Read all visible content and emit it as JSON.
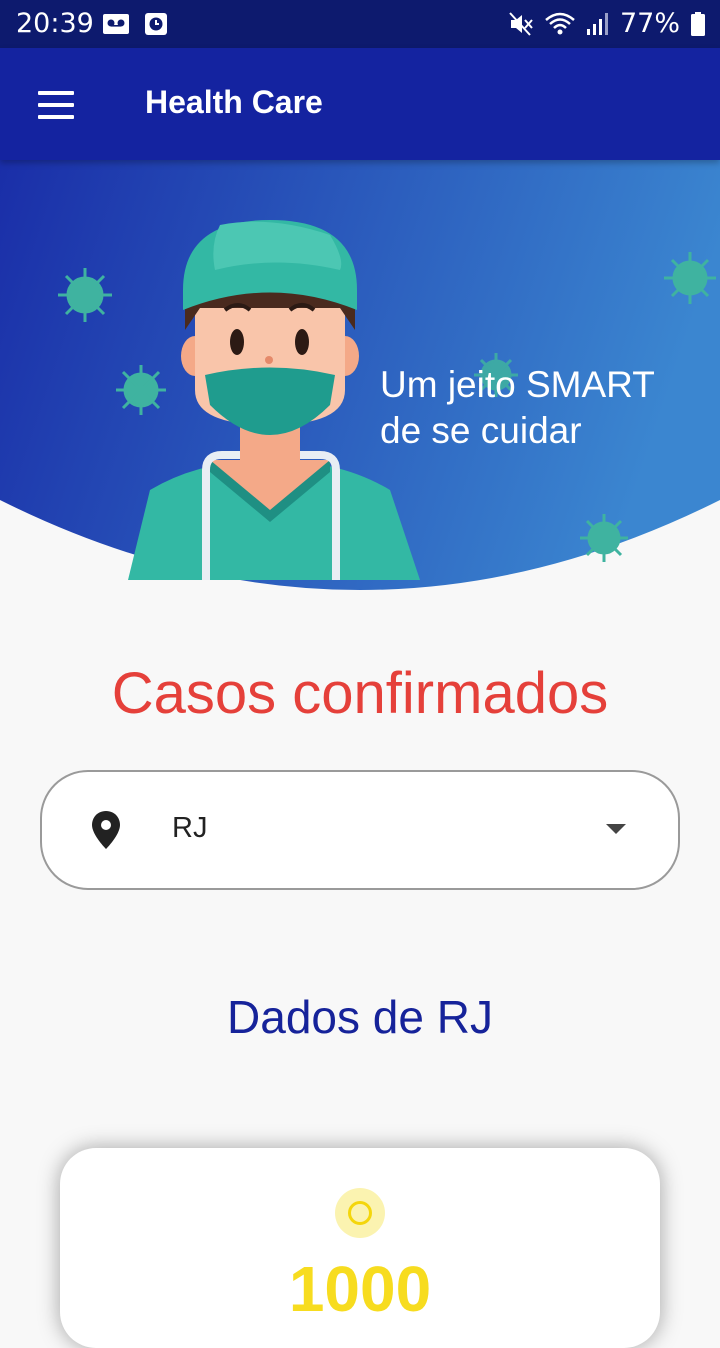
{
  "status_bar": {
    "time": "20:39",
    "battery_text": "77%",
    "icons": [
      "voicemail-icon",
      "clock-icon",
      "mute-icon",
      "wifi-icon",
      "signal-icon",
      "battery-icon"
    ]
  },
  "app_bar": {
    "title": "Health Care",
    "menu_icon": "menu-icon"
  },
  "hero": {
    "tagline_line1": "Um jeito SMART",
    "tagline_line2": "de se cuidar"
  },
  "cases": {
    "title": "Casos confirmados",
    "selector": {
      "icon": "location-pin-icon",
      "value": "RJ"
    }
  },
  "region_data": {
    "title": "Dados de RJ"
  },
  "card": {
    "icon": "sun-icon",
    "number": "1000"
  },
  "colors": {
    "status_bar": "#0d1a6e",
    "app_bar": "#1423a0",
    "cases_title": "#e5403a",
    "data_title": "#16239a",
    "card_number": "#f7dc1f",
    "hero_gradient_start": "#1a2ea8",
    "hero_gradient_end": "#3b86d0"
  }
}
